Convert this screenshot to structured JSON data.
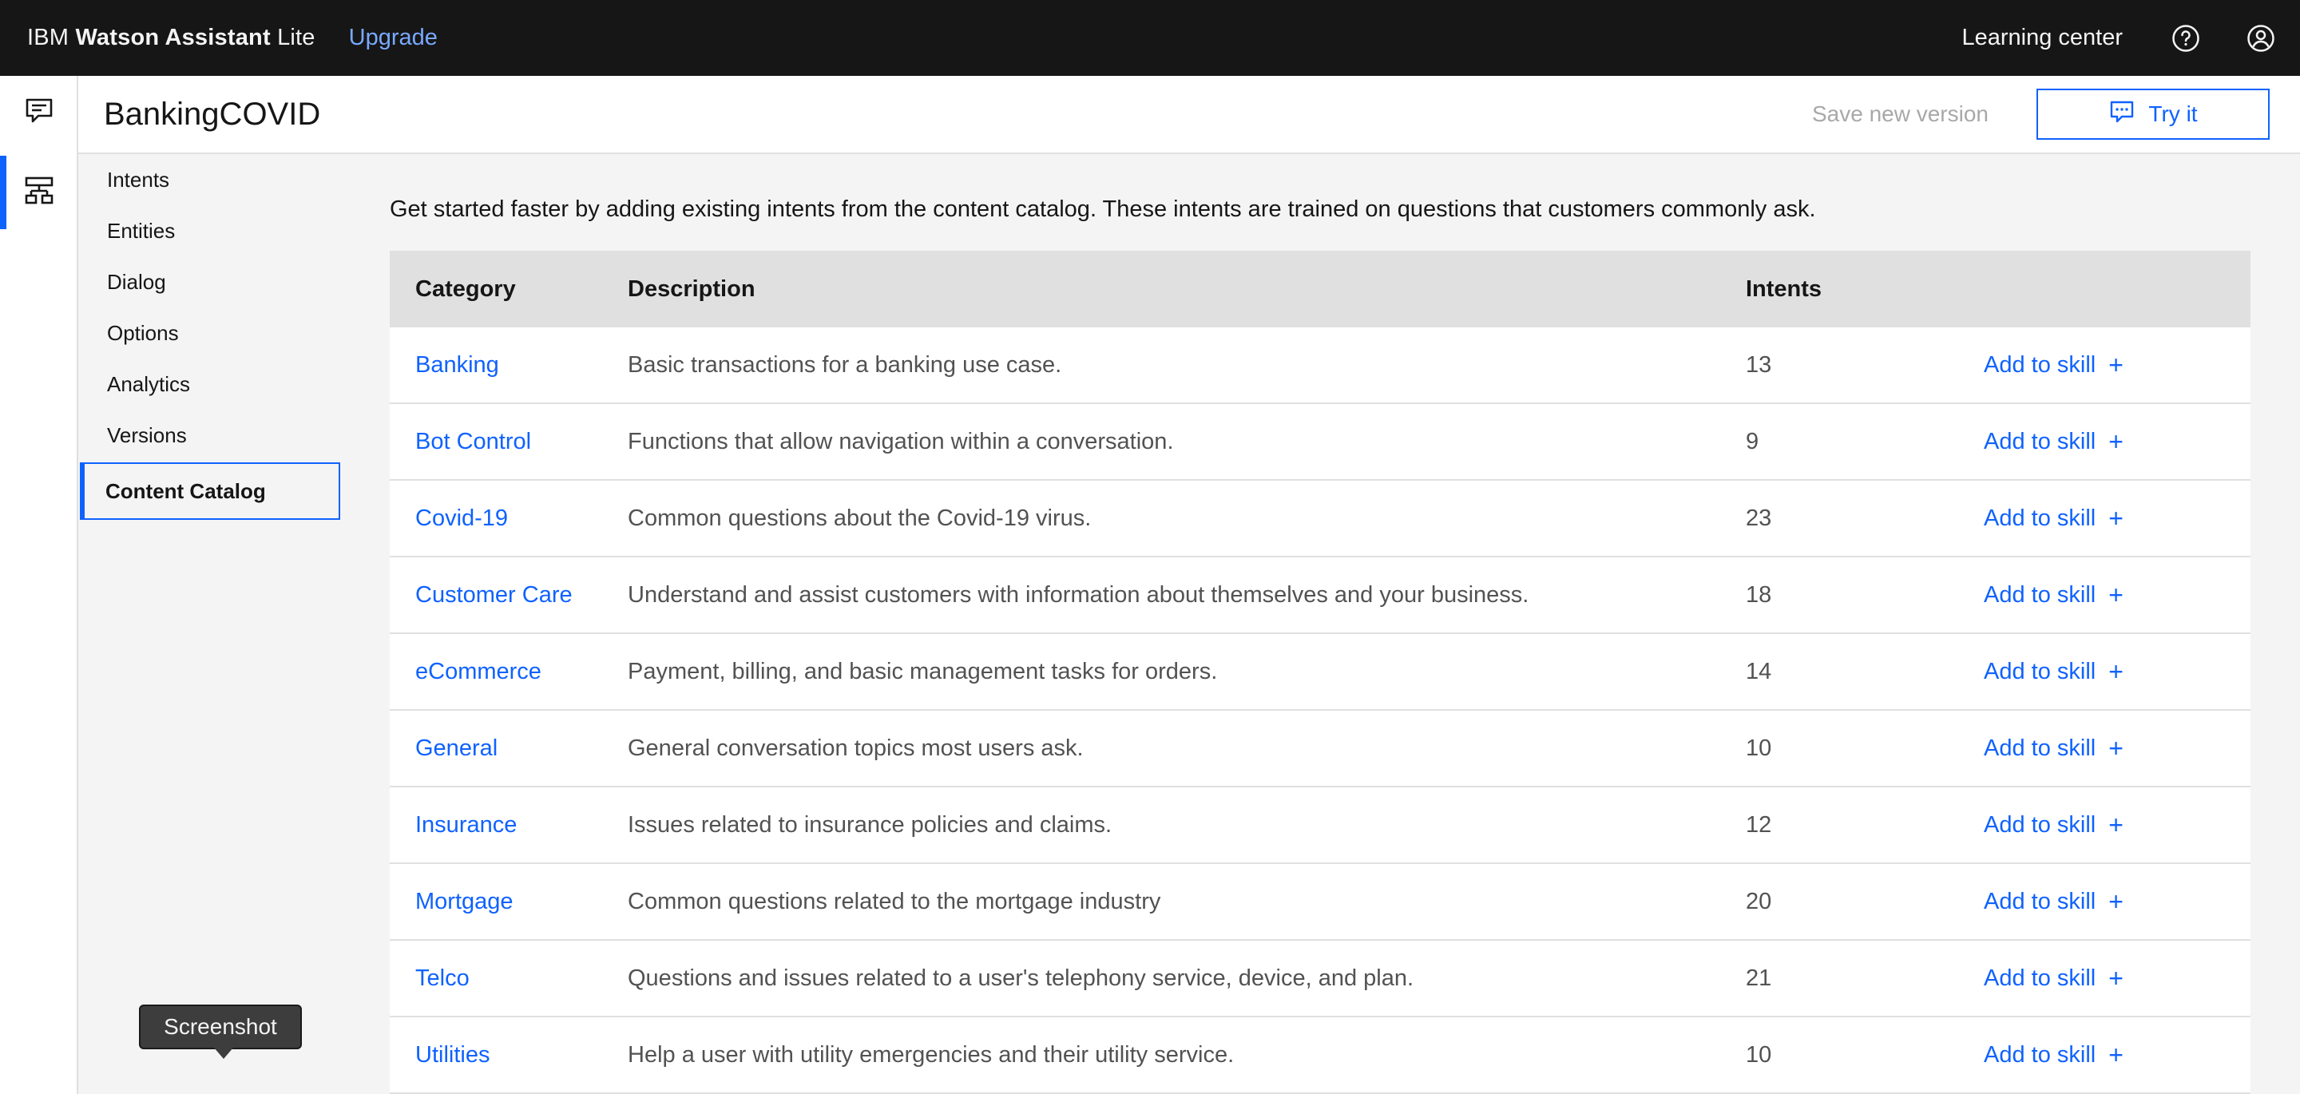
{
  "topbar": {
    "brand_prefix": "IBM",
    "brand_name": "Watson Assistant",
    "brand_suffix": "Lite",
    "upgrade": "Upgrade",
    "learning_center": "Learning center",
    "help_icon": "help-icon",
    "user_icon": "user-avatar-icon"
  },
  "rail": {
    "items": [
      {
        "icon": "chat-icon"
      },
      {
        "icon": "skill-tree-icon",
        "active": true
      }
    ]
  },
  "header": {
    "title": "BankingCOVID",
    "save_version": "Save new version",
    "try_it": "Try it"
  },
  "sidenav": {
    "items": [
      {
        "label": "Intents"
      },
      {
        "label": "Entities"
      },
      {
        "label": "Dialog"
      },
      {
        "label": "Options"
      },
      {
        "label": "Analytics"
      },
      {
        "label": "Versions"
      },
      {
        "label": "Content Catalog",
        "active": true
      }
    ]
  },
  "main": {
    "intro": "Get started faster by adding existing intents from the content catalog. These intents are trained on questions that customers commonly ask.",
    "columns": {
      "category": "Category",
      "description": "Description",
      "intents": "Intents"
    },
    "add_label": "Add to skill",
    "add_symbol": "+",
    "rows": [
      {
        "category": "Banking",
        "description": "Basic transactions for a banking use case.",
        "intents": "13"
      },
      {
        "category": "Bot Control",
        "description": "Functions that allow navigation within a conversation.",
        "intents": "9"
      },
      {
        "category": "Covid-19",
        "description": "Common questions about the Covid-19 virus.",
        "intents": "23"
      },
      {
        "category": "Customer Care",
        "description": "Understand and assist customers with information about themselves and your business.",
        "intents": "18"
      },
      {
        "category": "eCommerce",
        "description": "Payment, billing, and basic management tasks for orders.",
        "intents": "14"
      },
      {
        "category": "General",
        "description": "General conversation topics most users ask.",
        "intents": "10"
      },
      {
        "category": "Insurance",
        "description": "Issues related to insurance policies and claims.",
        "intents": "12"
      },
      {
        "category": "Mortgage",
        "description": "Common questions related to the mortgage industry",
        "intents": "20"
      },
      {
        "category": "Telco",
        "description": "Questions and issues related to a user's telephony service, device, and plan.",
        "intents": "21"
      },
      {
        "category": "Utilities",
        "description": "Help a user with utility emergencies and their utility service.",
        "intents": "10"
      }
    ]
  },
  "tooltip": {
    "label": "Screenshot"
  },
  "colors": {
    "topbar_bg": "#161616",
    "accent": "#0f62fe",
    "link_dark": "#78a9ff",
    "table_header_bg": "#e0e0e0",
    "page_bg": "#f4f4f4"
  }
}
